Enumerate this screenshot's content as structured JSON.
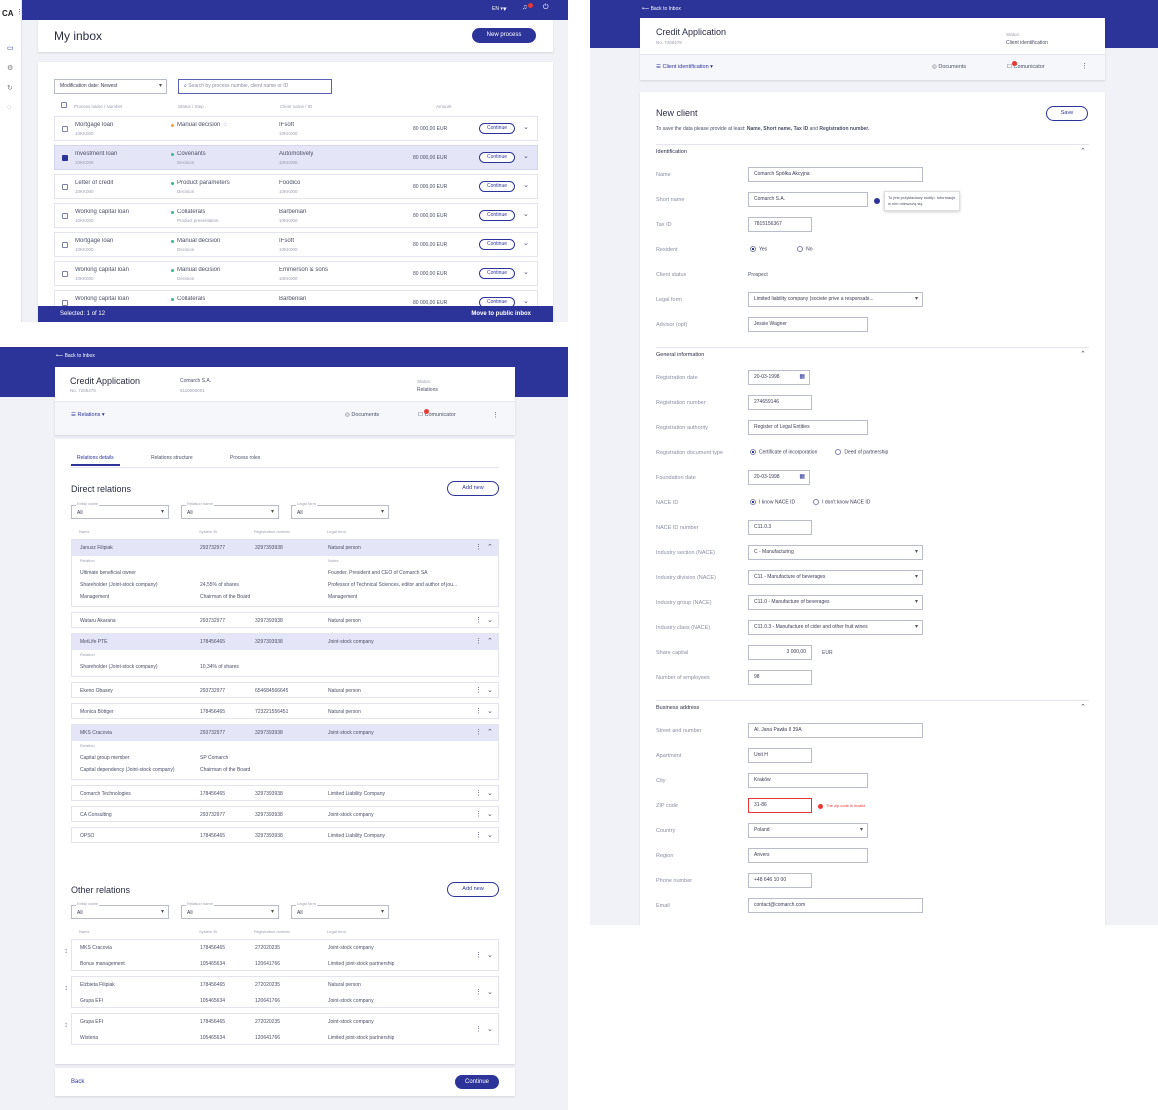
{
  "app": {
    "logo": "CA"
  },
  "inbox": {
    "lang": "EN",
    "title": "My inbox",
    "new_process": "New process",
    "sort_value": "Modification date: Newest",
    "search_placeholder": "Search by process number, client name or ID",
    "columns": [
      "Process name / Number",
      "Status / Step",
      "Client name / ID",
      "Amount"
    ],
    "rows": [
      {
        "name": "Mortgage loan",
        "num": "10KK000",
        "status": "Manual decision",
        "step": "",
        "client": "IFsoft",
        "cid": "10KK000",
        "amount": "80 000,00 EUR",
        "dot": "#f2a33a",
        "selected": false,
        "info": true
      },
      {
        "name": "Investment loan",
        "num": "10KK000",
        "status": "Covenants",
        "step": "Decision",
        "client": "Automotively",
        "cid": "10KK000",
        "amount": "80 000,00 EUR",
        "dot": "#3bb58a",
        "selected": true,
        "info": false
      },
      {
        "name": "Letter of credit",
        "num": "10KK000",
        "status": "Product parameters",
        "step": "Decision",
        "client": "Foodico",
        "cid": "10KK000",
        "amount": "80 000,00 EUR",
        "dot": "#3bb58a",
        "selected": false,
        "info": false
      },
      {
        "name": "Working capital loan",
        "num": "10KK000",
        "status": "Collaterals",
        "step": "Product presentation",
        "client": "Barbenian",
        "cid": "10KK000",
        "amount": "80 000,00 EUR",
        "dot": "#3bb58a",
        "selected": false,
        "info": false
      },
      {
        "name": "Mortgage loan",
        "num": "10KK000",
        "status": "Manual decision",
        "step": "Decision",
        "client": "IFsoft",
        "cid": "10KK000",
        "amount": "80 000,00 EUR",
        "dot": "#3bb58a",
        "selected": false,
        "info": false
      },
      {
        "name": "Working capital loan",
        "num": "10KK000",
        "status": "Manual decision",
        "step": "Decision",
        "client": "Emmerson & sons",
        "cid": "10KK000",
        "amount": "80 000,00 EUR",
        "dot": "#3bb58a",
        "selected": false,
        "info": false
      },
      {
        "name": "Working capital loan",
        "num": "10KK000",
        "status": "Collaterals",
        "step": "",
        "client": "Barbenian",
        "cid": "",
        "amount": "80 000,00 EUR",
        "dot": "#3bb58a",
        "selected": false,
        "info": false
      }
    ],
    "continue": "Continue",
    "selected_text": "Selected: 1 of 12",
    "move_public": "Move to public inbox"
  },
  "rel": {
    "back": "Back to Inbox",
    "title": "Credit Application",
    "number": "No. 7265478",
    "client": "Comarch S.A.",
    "client_id": "6110000001",
    "status_label": "Status:",
    "status_value": "Relations",
    "step": "Relations",
    "documents": "Documents",
    "communicator": "Comunicator",
    "tabs": [
      "Relations details",
      "Relations structure",
      "Process roles"
    ],
    "direct_title": "Direct relations",
    "other_title": "Other relations",
    "add_new": "Add new",
    "filter_labels": [
      "Entity name",
      "Relation name",
      "Legal form"
    ],
    "filter_value": "All",
    "cols": [
      "Name",
      "System ID",
      "Registration number",
      "Legal form"
    ],
    "direct": [
      {
        "name": "Janusz Filipiak",
        "sid": "293732977",
        "reg": "3297393938",
        "form": "Natural person",
        "open": true,
        "details": [
          [
            "Relation",
            "",
            "Notes"
          ],
          [
            "Ultimate beneficial owner",
            "",
            "Founder, President and CEO of Comarch SA"
          ],
          [
            "Shareholder (Joint-stock company)",
            "24,55% of shares",
            "Professor of Technical Sciences, editor and author of jou..."
          ],
          [
            "Management",
            "Chairman of the Board",
            "Management"
          ]
        ]
      },
      {
        "name": "Wataru Akarana",
        "sid": "293732977",
        "reg": "3297393938",
        "form": "Natural person",
        "open": false,
        "details": []
      },
      {
        "name": "MetLife PTE",
        "sid": "178456465",
        "reg": "3297393938",
        "form": "Joint-stock company",
        "open": true,
        "details": [
          [
            "Relation",
            "",
            ""
          ],
          [
            "Shareholder (Joint-stock company)",
            "10,34% of shares",
            ""
          ]
        ]
      },
      {
        "name": "Ekeno Obasey",
        "sid": "293732977",
        "reg": "654684566645",
        "form": "Natural person",
        "open": false,
        "details": []
      },
      {
        "name": "Monica Böttger",
        "sid": "178456465",
        "reg": "723221556451",
        "form": "Natural person",
        "open": false,
        "details": []
      },
      {
        "name": "MKS Cracovia",
        "sid": "293732977",
        "reg": "3297393938",
        "form": "Joint-stock company",
        "open": true,
        "details": [
          [
            "Relation",
            "",
            ""
          ],
          [
            "Capital group member",
            "SP Comarch",
            ""
          ],
          [
            "Capital dependency (Joint-stock company)",
            "Chairman of the Board",
            ""
          ]
        ]
      },
      {
        "name": "Comarch Technologies",
        "sid": "178456465",
        "reg": "3297393938",
        "form": "Limited Liability Company",
        "open": false,
        "details": []
      },
      {
        "name": "CA Consulting",
        "sid": "293732977",
        "reg": "3297393938",
        "form": "Joint-stock company",
        "open": false,
        "details": []
      },
      {
        "name": "OPSO",
        "sid": "178456465",
        "reg": "3297393938",
        "form": "Limited Liability Company",
        "open": false,
        "details": []
      }
    ],
    "other": [
      [
        {
          "name": "MKS Cracovia",
          "sid": "178456465",
          "reg": "272020235",
          "form": "Joint-stock company"
        },
        {
          "name": "Bonus management",
          "sid": "105465634",
          "reg": "120641766",
          "form": "Limited joint-stock partnership"
        }
      ],
      [
        {
          "name": "Elżbieta Filipiak",
          "sid": "178456465",
          "reg": "272020235",
          "form": "Natural person"
        },
        {
          "name": "Grupa EFI",
          "sid": "105465634",
          "reg": "120641766",
          "form": "Joint-stock company"
        }
      ],
      [
        {
          "name": "Grupa EFI",
          "sid": "178456465",
          "reg": "272020235",
          "form": "Joint-stock company"
        },
        {
          "name": "Wisteria",
          "sid": "105465634",
          "reg": "120641766",
          "form": "Limited joint-stock partnership"
        }
      ]
    ],
    "back_btn": "Back",
    "continue_btn": "Continue"
  },
  "client": {
    "back": "Back to Inbox",
    "title": "Credit Application",
    "number": "No. 7265478",
    "status_label": "Status:",
    "status_value": "Client identification",
    "step": "Client identification",
    "documents": "Documents",
    "communicator": "Comunicator",
    "form_title": "New client",
    "save": "Save",
    "hint_pre": "To save the data please provide at least: ",
    "hint_bold": "Name, Short name, Tax ID",
    "hint_and": " and ",
    "hint_bold2": "Registration number.",
    "sections": [
      "Identification",
      "General information",
      "Business address"
    ],
    "tooltip": "To jest przykładowy tooltip. Informacje w nim mieszczą się",
    "fields": [
      {
        "label": "Name",
        "value": "Comarch Spółka Akcyjna",
        "w": 175,
        "type": "input"
      },
      {
        "label": "Short name",
        "value": "Comarch S.A.",
        "w": 120,
        "type": "input",
        "tip": true
      },
      {
        "label": "Tax ID",
        "value": "7815156367",
        "w": 64,
        "type": "input"
      },
      {
        "label": "Resident",
        "opts": [
          "Yes",
          "No"
        ],
        "on": 0,
        "type": "radio"
      },
      {
        "label": "Client status",
        "value": "Prospect",
        "type": "text"
      },
      {
        "label": "Legal form",
        "value": "Limited liability company (societe prive a responsabi...",
        "w": 175,
        "type": "select"
      },
      {
        "label": "Advisor (opt)",
        "value": "Jessie Wagner",
        "w": 120,
        "type": "input"
      }
    ],
    "gen": [
      {
        "label": "Registration date",
        "value": "20-03-1998",
        "w": 62,
        "type": "date"
      },
      {
        "label": "Registration number",
        "value": "274659146",
        "w": 64,
        "type": "input"
      },
      {
        "label": "Registration authority",
        "value": "Register of Legal Entities",
        "w": 120,
        "type": "input"
      },
      {
        "label": "Registration document type",
        "opts": [
          "Certificate of incorporation",
          "Deed of partnership"
        ],
        "on": 0,
        "type": "radio"
      },
      {
        "label": "Foundation date",
        "value": "20-03-1998",
        "w": 62,
        "type": "date"
      },
      {
        "label": "NACE ID",
        "opts": [
          "I know NACE ID",
          "I don't know NACE ID"
        ],
        "on": 0,
        "type": "radio"
      },
      {
        "label": "NACE ID number",
        "value": "C11.0.3",
        "w": 64,
        "type": "input"
      },
      {
        "label": "Industry section (NACE)",
        "value": "C - Manufacturing",
        "w": 175,
        "type": "select"
      },
      {
        "label": "Industry division (NACE)",
        "value": "C11 - Manufacture of beverages",
        "w": 175,
        "type": "select"
      },
      {
        "label": "Industry group (NACE)",
        "value": "C11.0 - Manufacture of beverages",
        "w": 175,
        "type": "select"
      },
      {
        "label": "Industry class (NACE)",
        "value": "C11.0.3 - Manufacture of cider and other fruit wines",
        "w": 175,
        "type": "select"
      },
      {
        "label": "Share capital",
        "value": "3 000,00",
        "w": 64,
        "type": "money",
        "unit": "EUR"
      },
      {
        "label": "Number of employees",
        "value": "98",
        "w": 64,
        "type": "input"
      }
    ],
    "addr": [
      {
        "label": "Street and number",
        "value": "Al. Jana Pawła II 39A",
        "w": 175,
        "type": "input"
      },
      {
        "label": "Apartment",
        "value": "Unit H",
        "w": 64,
        "type": "input"
      },
      {
        "label": "City",
        "value": "Kraków",
        "w": 120,
        "type": "input"
      },
      {
        "label": "ZIP code",
        "value": "31-86",
        "w": 64,
        "type": "error",
        "err": "The zip code is invalid"
      },
      {
        "label": "Country",
        "value": "Poland",
        "w": 120,
        "type": "select"
      },
      {
        "label": "Region",
        "value": "Anvers",
        "w": 120,
        "type": "input"
      },
      {
        "label": "Phone number",
        "value": "+48 646 10 00",
        "w": 64,
        "type": "input"
      },
      {
        "label": "Email",
        "value": "contact@comarch.com",
        "w": 175,
        "type": "input"
      }
    ]
  }
}
